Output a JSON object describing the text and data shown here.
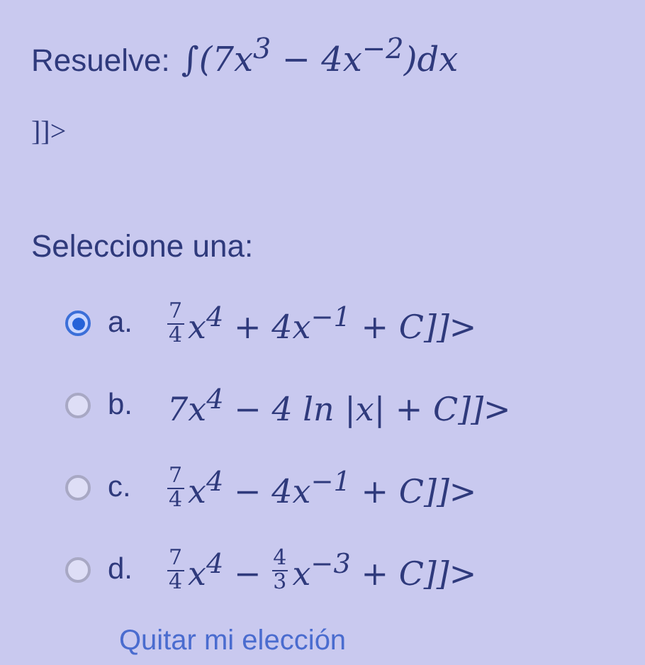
{
  "question": {
    "label": "Resuelve:",
    "math": "∫(7x$^{3}$ − 4x$^{−2}$)dx",
    "trailer": "]]>"
  },
  "prompt": "Seleccione una:",
  "options": [
    {
      "letter": "a.",
      "selected": true,
      "parts": [
        {
          "kind": "frac",
          "num": "7",
          "den": "4"
        },
        {
          "kind": "text",
          "text": "x$^{4}$ + 4x$^{−1}$ + C]]>"
        }
      ]
    },
    {
      "letter": "b.",
      "selected": false,
      "parts": [
        {
          "kind": "text",
          "text": "7x$^{4}$ − 4 ln |x| + C]]>"
        }
      ]
    },
    {
      "letter": "c.",
      "selected": false,
      "parts": [
        {
          "kind": "frac",
          "num": "7",
          "den": "4"
        },
        {
          "kind": "text",
          "text": "x$^{4}$ − 4x$^{−1}$ + C]]>"
        }
      ]
    },
    {
      "letter": "d.",
      "selected": false,
      "parts": [
        {
          "kind": "frac",
          "num": "7",
          "den": "4"
        },
        {
          "kind": "text",
          "text": "x$^{4}$ − "
        },
        {
          "kind": "frac",
          "num": "4",
          "den": "3"
        },
        {
          "kind": "text",
          "text": "x$^{−3}$ + C]]>"
        }
      ]
    }
  ],
  "clear_link": "Quitar mi elección"
}
